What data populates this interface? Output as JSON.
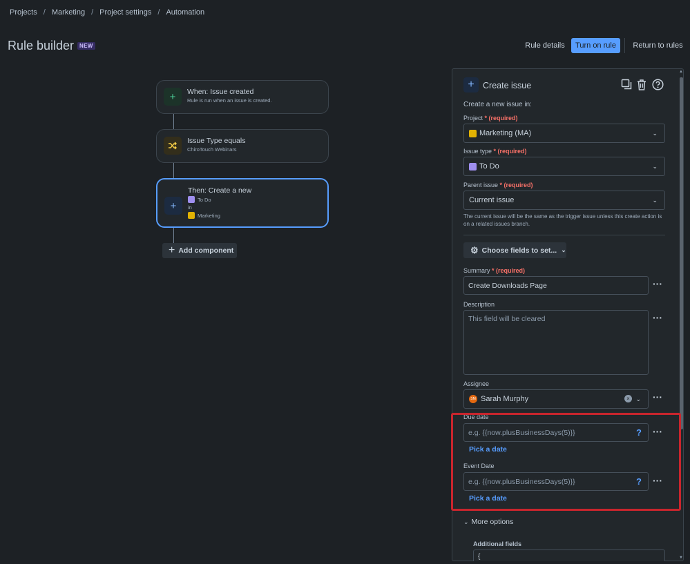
{
  "breadcrumb": [
    "Projects",
    "Marketing",
    "Project settings",
    "Automation"
  ],
  "header": {
    "title": "Rule builder",
    "badge": "NEW",
    "rule_details": "Rule details",
    "turn_on": "Turn on rule",
    "return_rules": "Return to rules"
  },
  "flow": {
    "trigger": {
      "title": "When: Issue created",
      "sub": "Rule is run when an issue is created."
    },
    "condition": {
      "title": "Issue Type equals",
      "sub": "ChiroTouch Webinars"
    },
    "action": {
      "title": "Then: Create a new",
      "issue_type": "To Do",
      "in_label": "in",
      "project": "Marketing"
    },
    "add_component": "Add component"
  },
  "panel": {
    "title": "Create issue",
    "intro": "Create a new issue in:",
    "required_label": "(required)",
    "project": {
      "label": "Project",
      "value": "Marketing (MA)"
    },
    "issue_type": {
      "label": "Issue type",
      "value": "To Do"
    },
    "parent_issue": {
      "label": "Parent issue",
      "value": "Current issue",
      "hint": "The current issue will be the same as the trigger issue unless this create action is on a related issues branch."
    },
    "choose_fields": "Choose fields to set...",
    "summary": {
      "label": "Summary",
      "value": "Create Downloads Page"
    },
    "description": {
      "label": "Description",
      "placeholder": "This field will be cleared"
    },
    "assignee": {
      "label": "Assignee",
      "value": "Sarah Murphy",
      "initials": "SM"
    },
    "due_date": {
      "label": "Due date",
      "placeholder": "e.g. {{now.plusBusinessDays(5)}}",
      "pick": "Pick a date"
    },
    "event_date": {
      "label": "Event Date",
      "placeholder": "e.g. {{now.plusBusinessDays(5)}}",
      "pick": "Pick a date"
    },
    "more_options": "More options",
    "additional_fields": {
      "label": "Additional fields",
      "value": "{"
    }
  },
  "colors": {
    "accent": "#579dff",
    "highlight_box": "#c9252d",
    "todo_icon": "#9f8fef",
    "project_icon": "#e2b203"
  }
}
